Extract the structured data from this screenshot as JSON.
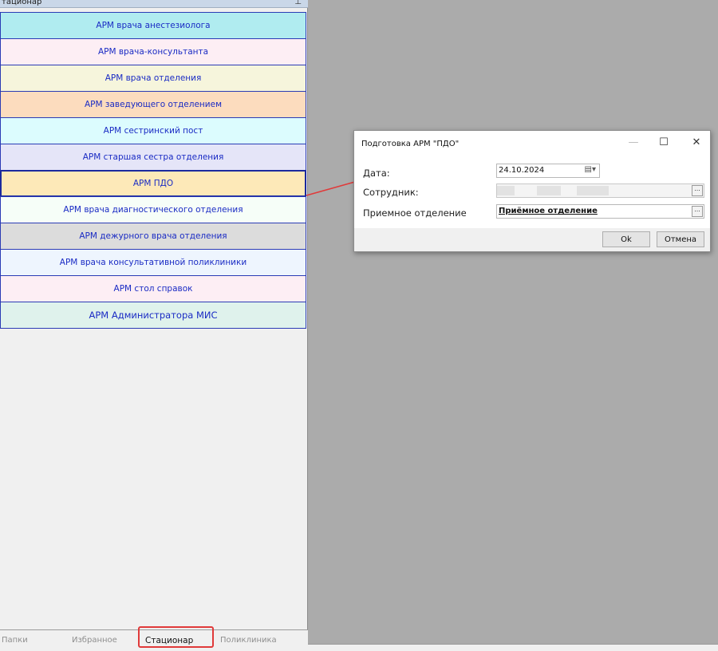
{
  "panel": {
    "title": "тационар",
    "pin_icon": "pin-icon"
  },
  "arm_buttons": [
    {
      "label": "АРМ врача анестезиолога",
      "color": "#b0ecf0"
    },
    {
      "label": "АРМ врача-консультанта",
      "color": "#fdeef4"
    },
    {
      "label": "АРМ врача отделения",
      "color": "#f6f5dc"
    },
    {
      "label": "АРМ заведующего отделением",
      "color": "#fcdcbe"
    },
    {
      "label": "АРМ сестринский пост",
      "color": "#dcfcfe"
    },
    {
      "label": "АРМ старшая сестра отделения",
      "color": "#e5e5f8"
    },
    {
      "label": "АРМ ПДО",
      "color": "#fde9b8",
      "selected": true
    },
    {
      "label": "АРМ врача диагностического отделения",
      "color": "#f6fef8"
    },
    {
      "label": "АРМ дежурного врача отделения",
      "color": "#dcdcdc"
    },
    {
      "label": "АРМ врача консультативной поликлиники",
      "color": "#eef5fe"
    },
    {
      "label": "АРМ стол справок",
      "color": "#fdeef4"
    },
    {
      "label": "АРМ Администратора МИС",
      "color": "#dff2ec"
    }
  ],
  "tabs": [
    "Папки",
    "Избранное",
    "Стационар",
    "Поликлиника"
  ],
  "active_tab": "Стационар",
  "dialog": {
    "title": "Подготовка АРМ \"ПДО\"",
    "date_label": "Дата:",
    "date_value": "24.10.2024",
    "employee_label": "Сотрудник:",
    "dept_label": "Приемное отделение",
    "dept_value": "Приёмное отделение",
    "ellipsis": "...",
    "ok": "Ok",
    "cancel": "Отмена",
    "minimize": "—",
    "maximize": "☐",
    "close": "✕"
  },
  "annotation_color": "#e03a3a"
}
